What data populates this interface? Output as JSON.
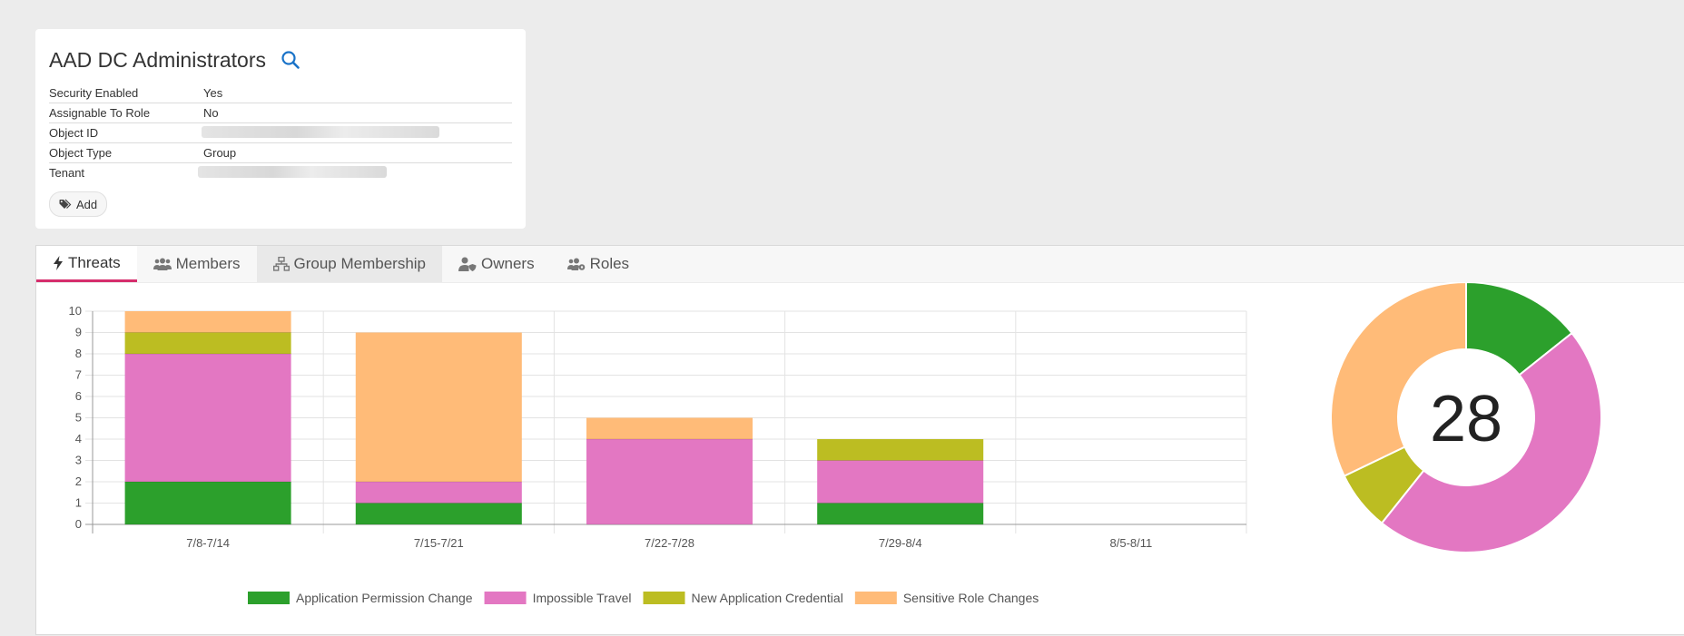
{
  "card": {
    "title": "AAD DC Administrators",
    "properties": [
      {
        "label": "Security Enabled",
        "value": "Yes",
        "redacted": false
      },
      {
        "label": "Assignable To Role",
        "value": "No",
        "redacted": false
      },
      {
        "label": "Object ID",
        "value": "",
        "redacted": true
      },
      {
        "label": "Object Type",
        "value": "Group",
        "redacted": false
      },
      {
        "label": "Tenant",
        "value": "",
        "redacted": true
      }
    ],
    "add_label": "Add"
  },
  "tabs": [
    {
      "label": "Threats",
      "icon": "bolt-icon"
    },
    {
      "label": "Members",
      "icon": "users-icon"
    },
    {
      "label": "Group Membership",
      "icon": "sitemap-icon"
    },
    {
      "label": "Owners",
      "icon": "user-shield-icon"
    },
    {
      "label": "Roles",
      "icon": "users-cog-icon"
    }
  ],
  "colors": {
    "accent": "#d62d6c",
    "link": "#1a73c8"
  },
  "chart_data": [
    {
      "type": "bar",
      "stacked": true,
      "categories": [
        "7/8-7/14",
        "7/15-7/21",
        "7/22-7/28",
        "7/29-8/4",
        "8/5-8/11"
      ],
      "series": [
        {
          "name": "Application Permission Change",
          "color": "#2ca02c",
          "values": [
            2,
            1,
            0,
            1,
            0
          ]
        },
        {
          "name": "Impossible Travel",
          "color": "#e377c2",
          "values": [
            6,
            1,
            4,
            2,
            0
          ]
        },
        {
          "name": "New Application Credential",
          "color": "#bcbd22",
          "values": [
            1,
            0,
            0,
            1,
            0
          ]
        },
        {
          "name": "Sensitive Role Changes",
          "color": "#ffbb78",
          "values": [
            1,
            7,
            1,
            0,
            0
          ]
        }
      ],
      "yticks": [
        "0",
        "1",
        "2",
        "3",
        "4",
        "5",
        "6",
        "7",
        "8",
        "9",
        "10"
      ],
      "ylim": [
        0,
        10
      ],
      "grid": true,
      "legend": "bottom"
    },
    {
      "type": "pie",
      "donut": true,
      "center_label": "28",
      "slices": [
        {
          "name": "Application Permission Change",
          "value": 4,
          "color": "#2ca02c"
        },
        {
          "name": "Impossible Travel",
          "value": 13,
          "color": "#e377c2"
        },
        {
          "name": "New Application Credential",
          "value": 2,
          "color": "#bcbd22"
        },
        {
          "name": "Sensitive Role Changes",
          "value": 9,
          "color": "#ffbb78"
        }
      ]
    }
  ]
}
